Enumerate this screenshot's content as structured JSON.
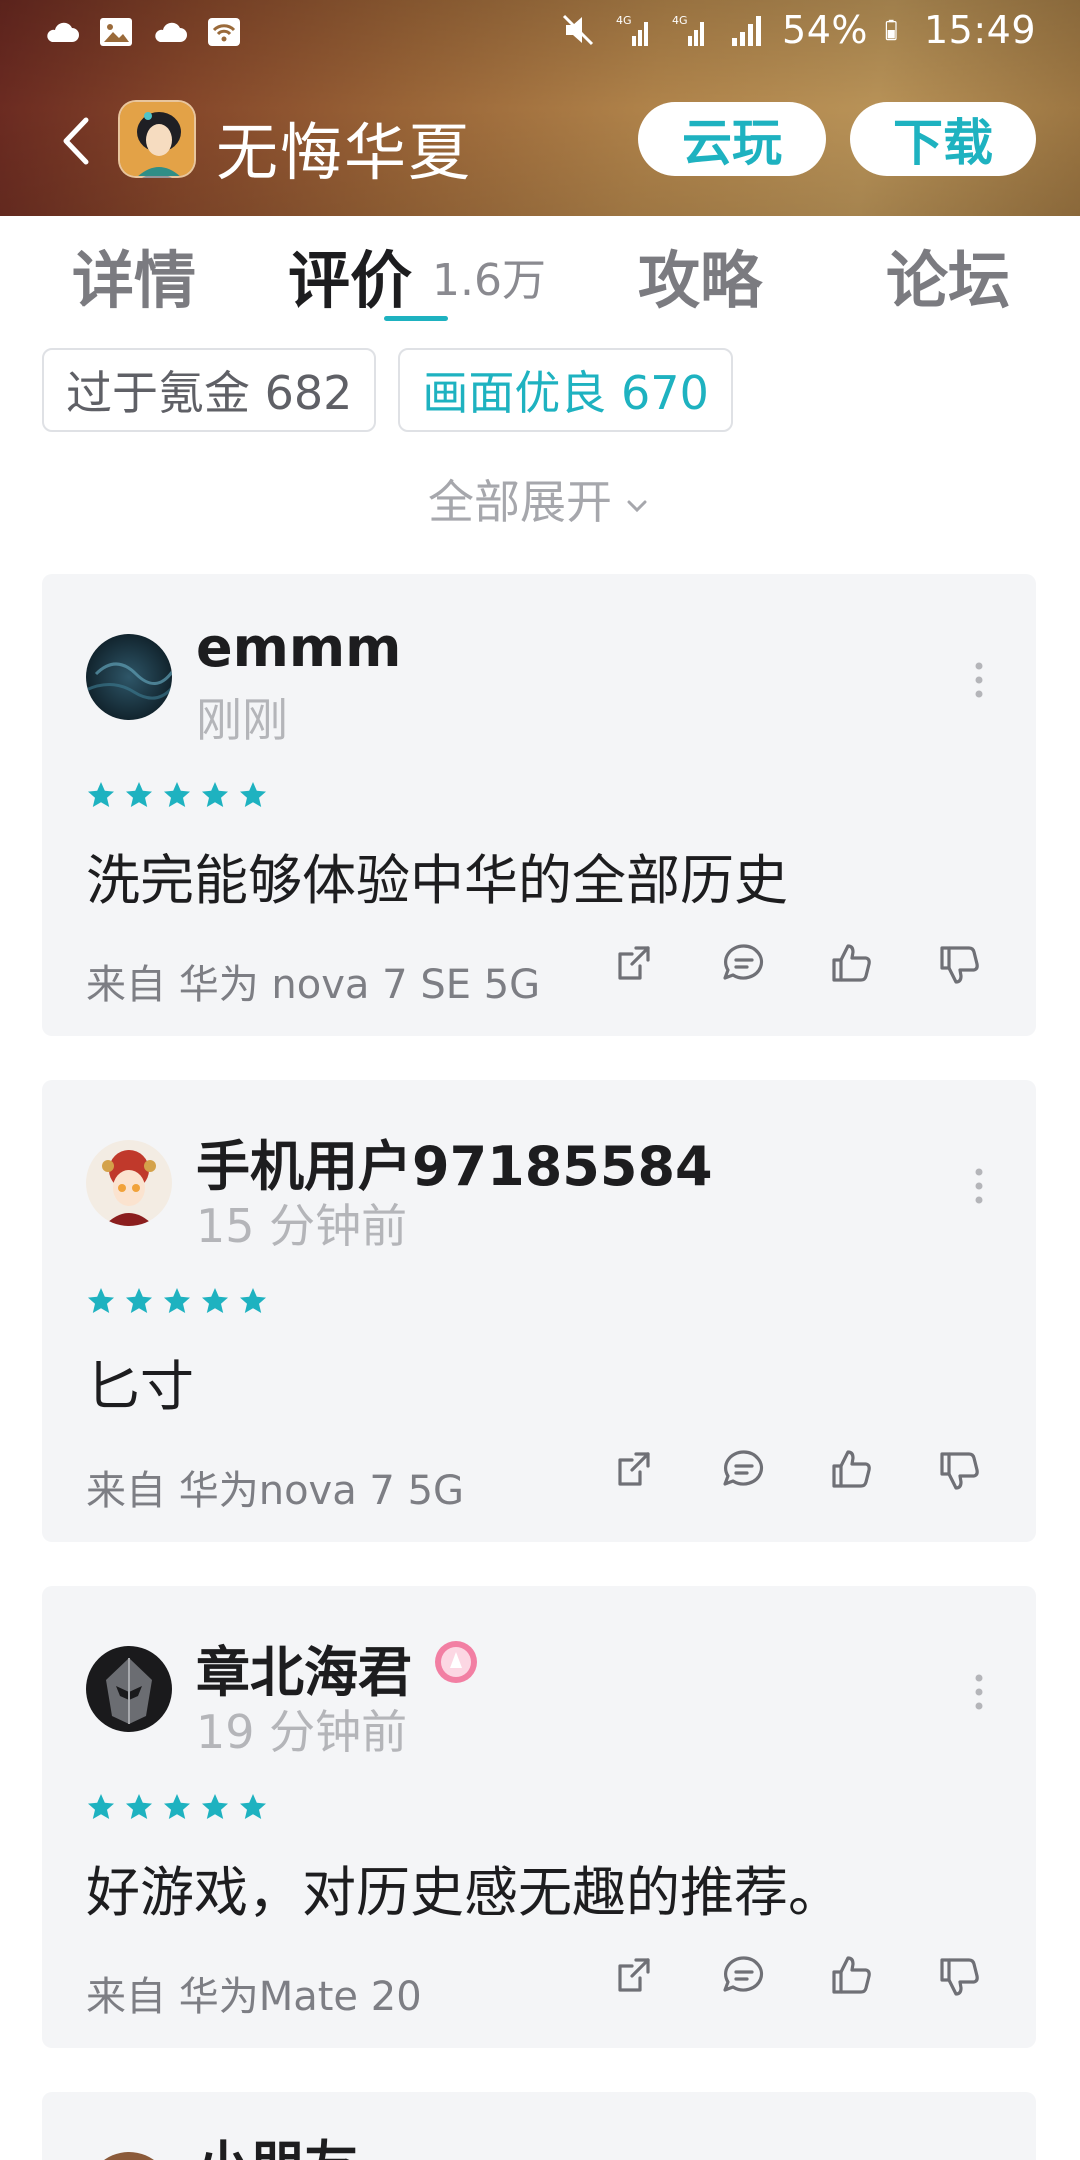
{
  "status_bar": {
    "battery": "54%",
    "time": "15:49",
    "icons": [
      "cloud-weather-icon",
      "image-icon",
      "cloud-weather-icon",
      "wifi-icon",
      "mute-icon",
      "signal-4g-icon",
      "signal-4g-icon",
      "signal-icon",
      "battery-icon"
    ]
  },
  "header": {
    "title": "无悔华夏",
    "cloud_play_label": "云玩",
    "download_label": "下载",
    "accent_color": "#1eb2c0"
  },
  "tabs": [
    {
      "label": "详情"
    },
    {
      "label": "评价",
      "count": "1.6万",
      "active": true
    },
    {
      "label": "攻略"
    },
    {
      "label": "论坛"
    }
  ],
  "tags": [
    {
      "label": "过于氪金 682"
    },
    {
      "label": "画面优良 670"
    }
  ],
  "expand_all_label": "全部展开",
  "reviews": [
    {
      "username": "emmm",
      "time": "刚刚",
      "rating": 5,
      "text": "洗完能够体验中华的全部历史",
      "device": "来自 华为 nova 7 SE 5G"
    },
    {
      "username": "手机用户97185584",
      "time": "15 分钟前",
      "rating": 5,
      "text": "匕寸",
      "device": "来自 华为nova 7 5G"
    },
    {
      "username": "章北海君",
      "time": "19 分钟前",
      "rating": 5,
      "text": "好游戏，对历史感无趣的推荐。",
      "device": "来自 华为Mate 20"
    },
    {
      "username": "小朋友"
    }
  ]
}
